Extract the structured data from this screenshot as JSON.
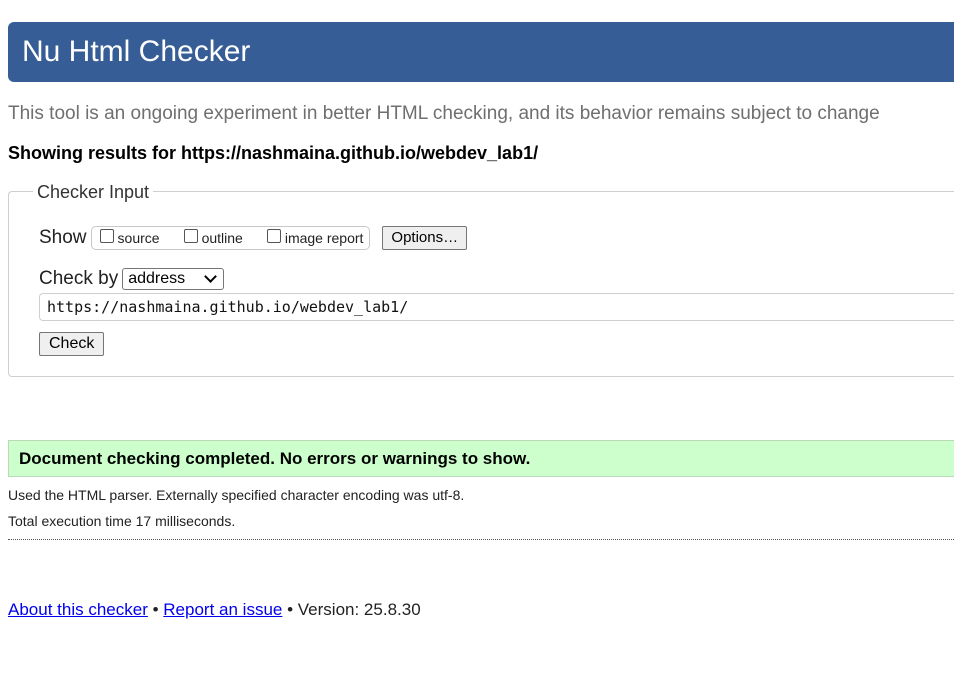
{
  "header": {
    "title": "Nu Html Checker"
  },
  "tagline": "This tool is an ongoing experiment in better HTML checking, and its behavior remains subject to change",
  "results_for": {
    "prefix": "Showing results for",
    "url": "https://nashmaina.github.io/webdev_lab1/"
  },
  "checker_input": {
    "legend": "Checker Input",
    "show_label": "Show",
    "show_options": [
      {
        "label": "source",
        "checked": false
      },
      {
        "label": "outline",
        "checked": false
      },
      {
        "label": "image report",
        "checked": false
      }
    ],
    "options_button": "Options…",
    "check_by_label": "Check by",
    "check_by_selected": "address",
    "url_value": "https://nashmaina.github.io/webdev_lab1/",
    "check_button": "Check"
  },
  "result": {
    "success_message": "Document checking completed. No errors or warnings to show.",
    "parser_info": "Used the HTML parser. Externally specified character encoding was utf-8.",
    "execution_time": "Total execution time 17 milliseconds."
  },
  "footer": {
    "about_link": "About this checker",
    "separator": "•",
    "report_link": "Report an issue",
    "version": "Version: 25.8.30"
  },
  "colors": {
    "header_bg": "#365d95",
    "success_bg": "#ccffcc",
    "link": "#0000ee"
  }
}
